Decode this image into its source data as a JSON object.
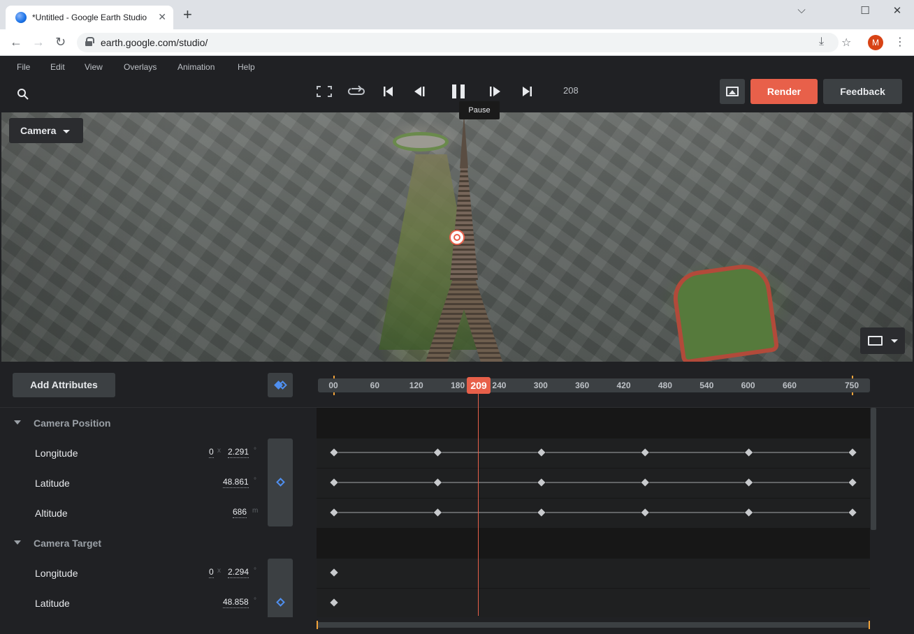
{
  "browser": {
    "tab_title": "*Untitled - Google Earth Studio",
    "tab_close": "✕",
    "new_tab": "+",
    "url": "earth.google.com/studio/",
    "avatar_letter": "M",
    "window_controls": [
      "⌵",
      "☐",
      "✕"
    ]
  },
  "menu": [
    "File",
    "Edit",
    "View",
    "Overlays",
    "Animation",
    "Help"
  ],
  "toolbar": {
    "frame": "208",
    "render_label": "Render",
    "feedback_label": "Feedback",
    "tooltip": "Pause"
  },
  "viewport": {
    "view_label": "Camera"
  },
  "timeline": {
    "add_attributes_label": "Add Attributes",
    "playhead_frame": "209",
    "ruler_labels": [
      "00",
      "60",
      "120",
      "180",
      "240",
      "300",
      "360",
      "420",
      "480",
      "540",
      "600",
      "660",
      "750"
    ],
    "ruler_max": 750,
    "playhead_value": 209
  },
  "groups": [
    {
      "name": "Camera Position",
      "attributes": [
        {
          "name": "Longitude",
          "prefix": "0",
          "sep": "x",
          "value": "2.291",
          "unit": "°",
          "keyframes": [
            0,
            150,
            300,
            450,
            600,
            750
          ]
        },
        {
          "name": "Latitude",
          "value": "48.861",
          "unit": "°",
          "keyframes": [
            0,
            150,
            300,
            450,
            600,
            750
          ]
        },
        {
          "name": "Altitude",
          "value": "686",
          "unit": "m",
          "keyframes": [
            0,
            150,
            300,
            450,
            600,
            750
          ]
        }
      ]
    },
    {
      "name": "Camera Target",
      "attributes": [
        {
          "name": "Longitude",
          "prefix": "0",
          "sep": "x",
          "value": "2.294",
          "unit": "°",
          "keyframes": [
            0
          ]
        },
        {
          "name": "Latitude",
          "value": "48.858",
          "unit": "°",
          "keyframes": [
            0
          ]
        }
      ]
    }
  ],
  "colors": {
    "accent": "#e8604a",
    "keyframe": "#4f8ff0",
    "marker": "#f2a33a"
  }
}
